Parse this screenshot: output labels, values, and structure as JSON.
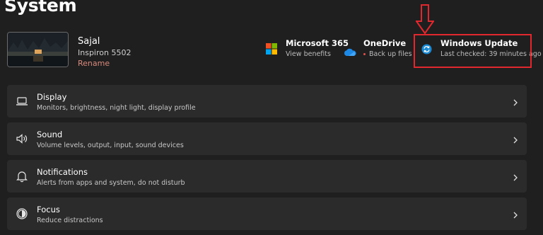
{
  "page": {
    "title": "System"
  },
  "device": {
    "name": "Sajal",
    "model": "Inspiron 5502",
    "rename_label": "Rename"
  },
  "quick_tiles": [
    {
      "title": "Microsoft 365",
      "subtitle": "View benefits",
      "icon": "microsoft-logo-icon"
    },
    {
      "title": "OneDrive",
      "subtitle": "Back up files",
      "icon": "onedrive-cloud-icon",
      "status_dot_color": "#e0514c"
    },
    {
      "title": "Windows Update",
      "subtitle": "Last checked: 39 minutes ago",
      "icon": "windows-update-icon"
    }
  ],
  "annotation": {
    "highlight_color": "#e0282e"
  },
  "settings": [
    {
      "title": "Display",
      "subtitle": "Monitors, brightness, night light, display profile",
      "icon": "laptop-icon"
    },
    {
      "title": "Sound",
      "subtitle": "Volume levels, output, input, sound devices",
      "icon": "speaker-icon"
    },
    {
      "title": "Notifications",
      "subtitle": "Alerts from apps and system, do not disturb",
      "icon": "bell-icon"
    },
    {
      "title": "Focus",
      "subtitle": "Reduce distractions",
      "icon": "focus-icon"
    }
  ]
}
